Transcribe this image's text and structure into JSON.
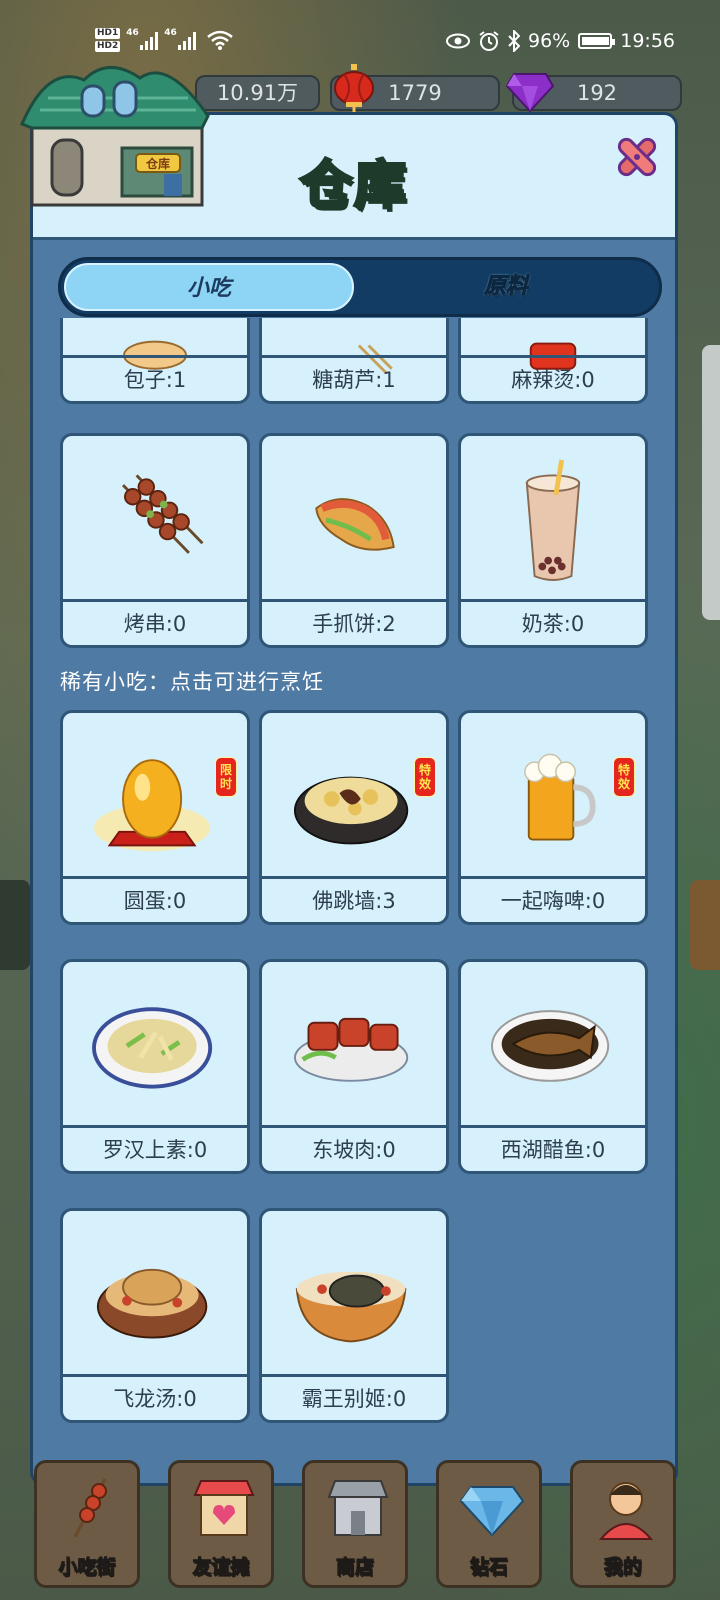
{
  "status_bar": {
    "hd1": "HD1",
    "hd2": "HD2",
    "signal1_label": "46",
    "signal2_label": "46",
    "battery_percent": "96%",
    "time": "19:56"
  },
  "currency": {
    "coins": "10.91万",
    "lanterns": "1779",
    "gems": "192"
  },
  "modal": {
    "title": "仓库",
    "badge_sign": "仓库"
  },
  "tabs": [
    {
      "label": "小吃",
      "active": true
    },
    {
      "label": "原料",
      "active": false
    }
  ],
  "snacks": [
    {
      "name": "包子:1",
      "icon": "baozi-icon"
    },
    {
      "name": "糖葫芦:1",
      "icon": "tanghulu-icon"
    },
    {
      "name": "麻辣烫:0",
      "icon": "malatang-icon"
    },
    {
      "name": "烤串:0",
      "icon": "kebab-icon"
    },
    {
      "name": "手抓饼:2",
      "icon": "pancake-icon"
    },
    {
      "name": "奶茶:0",
      "icon": "milk-tea-icon"
    }
  ],
  "rare_section_title": "稀有小吃：点击可进行烹饪",
  "rare_snacks": [
    {
      "name": "圆蛋:0",
      "icon": "golden-egg-icon",
      "badge": "限时"
    },
    {
      "name": "佛跳墙:3",
      "icon": "fotiaoqiang-icon",
      "badge": "特效"
    },
    {
      "name": "一起嗨啤:0",
      "icon": "beer-icon",
      "badge": "特效"
    },
    {
      "name": "罗汉上素:0",
      "icon": "luohan-vegetable-icon"
    },
    {
      "name": "东坡肉:0",
      "icon": "dongpo-pork-icon"
    },
    {
      "name": "西湖醋鱼:0",
      "icon": "west-lake-fish-icon"
    },
    {
      "name": "飞龙汤:0",
      "icon": "feilong-soup-icon"
    },
    {
      "name": "霸王别姬:0",
      "icon": "bawang-bieji-icon"
    }
  ],
  "bottom_nav": [
    {
      "label": "小吃街",
      "icon": "kebab-street-icon"
    },
    {
      "label": "友谊摊",
      "icon": "friend-stall-icon"
    },
    {
      "label": "商店",
      "icon": "shop-icon"
    },
    {
      "label": "钻石",
      "icon": "diamond-icon"
    },
    {
      "label": "我的",
      "icon": "profile-icon"
    }
  ],
  "colors": {
    "modal_bg": "#4f7aa4",
    "card_bg": "#d6f1fb",
    "tab_active": "#8ed4f5",
    "title_yellow": "#ffe34a",
    "badge_red": "#e5261f"
  }
}
